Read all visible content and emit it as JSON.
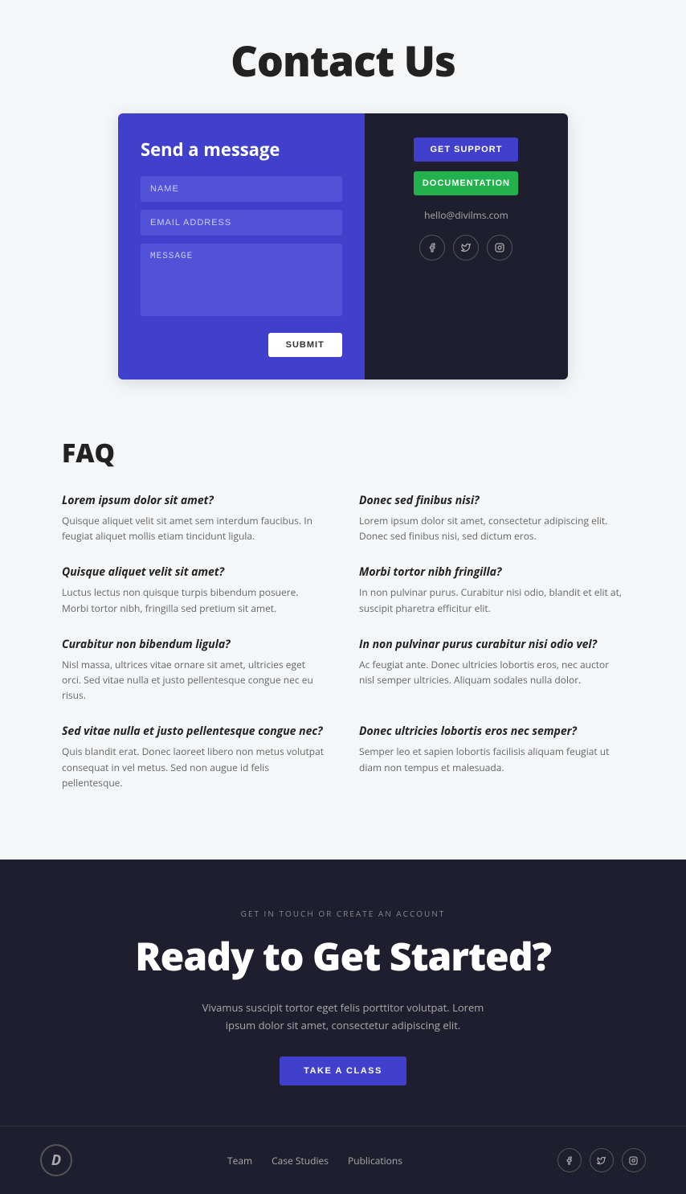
{
  "page": {
    "title": "Contact Us"
  },
  "contact_card": {
    "form_title": "Send a message",
    "name_placeholder": "NAME",
    "email_placeholder": "EMAIL ADDRESS",
    "message_placeholder": "MESSAGE",
    "submit_label": "SUBMIT",
    "support_btn": "GET SUPPORT",
    "docs_btn": "DOCUMENTATION",
    "email": "hello@divilms.com"
  },
  "social": {
    "facebook": "f",
    "twitter": "t",
    "instagram": "in"
  },
  "faq": {
    "title": "FAQ",
    "items": [
      {
        "question": "Lorem ipsum dolor sit amet?",
        "answer": "Quisque aliquet velit sit amet sem interdum faucibus. In feugiat aliquet mollis etiam tincidunt ligula."
      },
      {
        "question": "Donec sed finibus nisi?",
        "answer": "Lorem ipsum dolor sit amet, consectetur adipiscing elit. Donec sed finibus nisi, sed dictum eros."
      },
      {
        "question": "Quisque aliquet velit sit amet?",
        "answer": "Luctus lectus non quisque turpis bibendum posuere. Morbi tortor nibh, fringilla sed pretium sit amet."
      },
      {
        "question": "Morbi tortor nibh fringilla?",
        "answer": "In non pulvinar purus. Curabitur nisi odio, blandit et elit at, suscipit pharetra efficitur elit."
      },
      {
        "question": "Curabitur non bibendum ligula?",
        "answer": "Nisl massa, ultrices vitae ornare sit amet, ultricies eget orci. Sed vitae nulla et justo pellentesque congue nec eu risus."
      },
      {
        "question": "In non pulvinar purus curabitur nisi odio vel?",
        "answer": "Ac feugiat ante. Donec ultricies lobortis eros, nec auctor nisl semper ultricies. Aliquam sodales nulla dolor."
      },
      {
        "question": "Sed vitae nulla et justo pellentesque congue nec?",
        "answer": "Quis blandit erat. Donec laoreet libero non metus volutpat consequat in vel metus. Sed non augue id felis pellentesque."
      },
      {
        "question": "Donec ultricies lobortis eros nec semper?",
        "answer": "Semper leo et sapien lobortis facilisis aliquam feugiat ut diam non tempus et malesuada."
      }
    ]
  },
  "cta": {
    "eyebrow": "GET IN TOUCH OR CREATE AN ACCOUNT",
    "heading": "Ready to Get Started?",
    "text": "Vivamus suscipit tortor eget felis porttitor volutpat. Lorem ipsum dolor sit amet, consectetur adipiscing elit.",
    "button_label": "TAKE A CLASS"
  },
  "footer": {
    "logo": "D",
    "nav_items": [
      "Team",
      "Case Studies",
      "Publications"
    ]
  }
}
